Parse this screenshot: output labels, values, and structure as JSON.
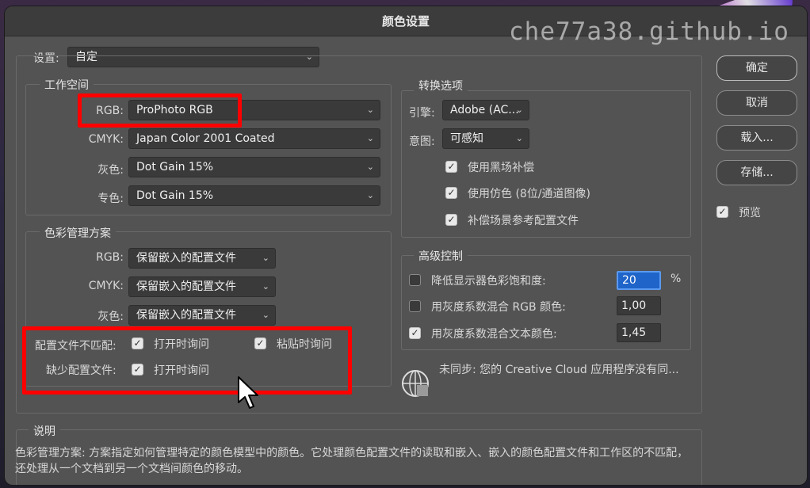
{
  "window": {
    "title": "颜色设置"
  },
  "watermark": "che77a38.github.io",
  "settings": {
    "label": "设置:",
    "value": "自定"
  },
  "working_spaces": {
    "title": "工作空间",
    "rows": [
      {
        "label": "RGB:",
        "value": "ProPhoto RGB"
      },
      {
        "label": "CMYK:",
        "value": "Japan Color 2001 Coated"
      },
      {
        "label": "灰色:",
        "value": "Dot Gain 15%"
      },
      {
        "label": "专色:",
        "value": "Dot Gain 15%"
      }
    ]
  },
  "color_management": {
    "title": "色彩管理方案",
    "rows": [
      {
        "label": "RGB:",
        "value": "保留嵌入的配置文件"
      },
      {
        "label": "CMYK:",
        "value": "保留嵌入的配置文件"
      },
      {
        "label": "灰色:",
        "value": "保留嵌入的配置文件"
      }
    ],
    "mismatch_label": "配置文件不匹配:",
    "mismatch_open": "打开时询问",
    "mismatch_paste": "粘贴时询问",
    "missing_label": "缺少配置文件:",
    "missing_open": "打开时询问"
  },
  "conversion": {
    "title": "转换选项",
    "engine_label": "引擎:",
    "engine_value": "Adobe (AC...",
    "intent_label": "意图:",
    "intent_value": "可感知",
    "black_point": "使用黑场补偿",
    "dither": "使用仿色 (8位/通道图像)",
    "scene_referred": "补偿场景参考配置文件"
  },
  "advanced": {
    "title": "高级控制",
    "desaturate_label": "降低显示器色彩饱和度:",
    "desaturate_value": "20",
    "desaturate_unit": "%",
    "blend_rgb_label": "用灰度系数混合 RGB 颜色:",
    "blend_rgb_value": "1,00",
    "blend_text_label": "用灰度系数混合文本颜色:",
    "blend_text_value": "1,45"
  },
  "sync_status": "未同步: 您的 Creative Cloud 应用程序没有同...",
  "buttons": {
    "ok": "确定",
    "cancel": "取消",
    "load": "载入...",
    "save": "存储..."
  },
  "preview_label": "预览",
  "description": {
    "title": "说明",
    "text": "色彩管理方案: 方案指定如何管理特定的颜色模型中的颜色。它处理颜色配置文件的读取和嵌入、嵌入的颜色配置文件和工作区的不匹配，还处理从一个文档到另一个文档间颜色的移动。"
  },
  "checkboxes": {
    "mismatch_open": true,
    "mismatch_paste": true,
    "missing_open": true,
    "black_point": true,
    "dither": true,
    "scene_referred": true,
    "desaturate": false,
    "blend_rgb": false,
    "blend_text": true,
    "preview": true
  }
}
